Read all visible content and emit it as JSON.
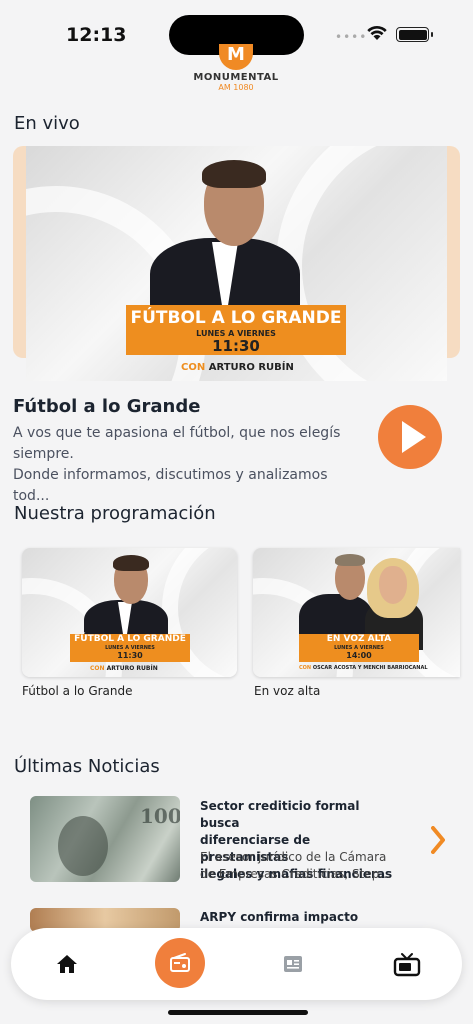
{
  "status_bar": {
    "time": "12:13",
    "dots": "••••"
  },
  "logo": {
    "mark": "M",
    "name": "MONUMENTAL",
    "frequency": "AM 1080"
  },
  "live": {
    "section_title": "En vivo",
    "banner": {
      "show_title": "FÚTBOL A LO GRANDE",
      "schedule_days": "LUNES A VIERNES",
      "schedule_time": "11:30",
      "con_label": "CON",
      "host": "ARTURO RUBÍN"
    },
    "program_title": "Fútbol a lo Grande",
    "description_line1": "A vos que te apasiona el fútbol, que nos elegís",
    "description_line2": "siempre.",
    "description_line3": "Donde informamos, discutimos y analizamos tod..."
  },
  "programming": {
    "section_title": "Nuestra programación",
    "cards": [
      {
        "label": "Fútbol a lo Grande",
        "show_title": "FÚTBOL A LO GRANDE",
        "days": "LUNES A VIERNES",
        "time": "11:30",
        "con": "CON",
        "hosts": "ARTURO RUBÍN"
      },
      {
        "label": "En voz alta",
        "show_title": "EN VOZ ALTA",
        "days": "LUNES A VIERNES",
        "time": "14:00",
        "con": "CON",
        "hosts": "OSCAR ACOSTA Y MENCHI BARRIOCANAL"
      }
    ]
  },
  "news": {
    "section_title": "Últimas Noticias",
    "items": [
      {
        "title_line1": "Sector crediticio formal busca",
        "title_line2": "diferenciarse de prestamistas",
        "title_line3": "ilegales y mafias financieras",
        "sub_line1": "El asesor jurídico de la Cámara",
        "sub_line2": "de Empresas Crediticias, Step..."
      },
      {
        "title_line1": "ARPY confirma impacto"
      }
    ]
  },
  "tabbar": {
    "items": [
      "home-icon",
      "radio-icon",
      "news-icon",
      "tv-icon"
    ],
    "active": "radio-icon"
  },
  "colors": {
    "accent": "#f07f3c",
    "banner_orange": "#ee8e1f",
    "background": "#f4f4f5"
  }
}
